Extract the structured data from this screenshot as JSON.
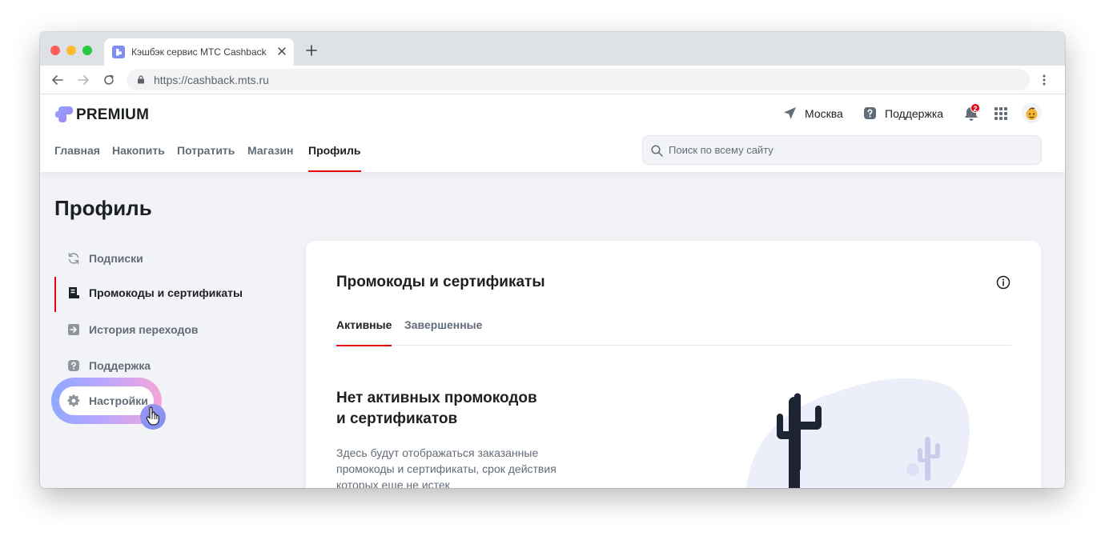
{
  "browser": {
    "tab_title": "Кэшбэк сервис МТС Cashback",
    "url": "https://cashback.mts.ru"
  },
  "header": {
    "logo_text": "PREMIUM",
    "city": "Москва",
    "support": "Поддержка",
    "notification_count": "2",
    "nav": [
      "Главная",
      "Накопить",
      "Потратить",
      "Магазин",
      "Профиль"
    ],
    "active_nav": "Профиль",
    "search_placeholder": "Поиск по всему сайту"
  },
  "page": {
    "title": "Профиль",
    "sidebar": [
      {
        "label": "Подписки",
        "icon": "refresh-icon"
      },
      {
        "label": "Промокоды и сертификаты",
        "icon": "receipt-icon",
        "active": true
      },
      {
        "label": "История переходов",
        "icon": "arrow-in-icon"
      },
      {
        "label": "Поддержка",
        "icon": "question-icon"
      },
      {
        "label": "Настройки",
        "icon": "gear-icon"
      }
    ]
  },
  "card": {
    "title": "Промокоды и сертификаты",
    "tabs": [
      "Активные",
      "Завершенные"
    ],
    "active_tab": "Активные",
    "empty_title_line1": "Нет активных промокодов",
    "empty_title_line2": "и сертификатов",
    "empty_text": "Здесь будут отображаться заказанные промокоды и сертификаты, срок действия которых еще не истек"
  },
  "colors": {
    "accent": "#e30611",
    "text": "#1d2023",
    "secondary_text": "#626c77",
    "page_background": "#f2f3f7"
  }
}
